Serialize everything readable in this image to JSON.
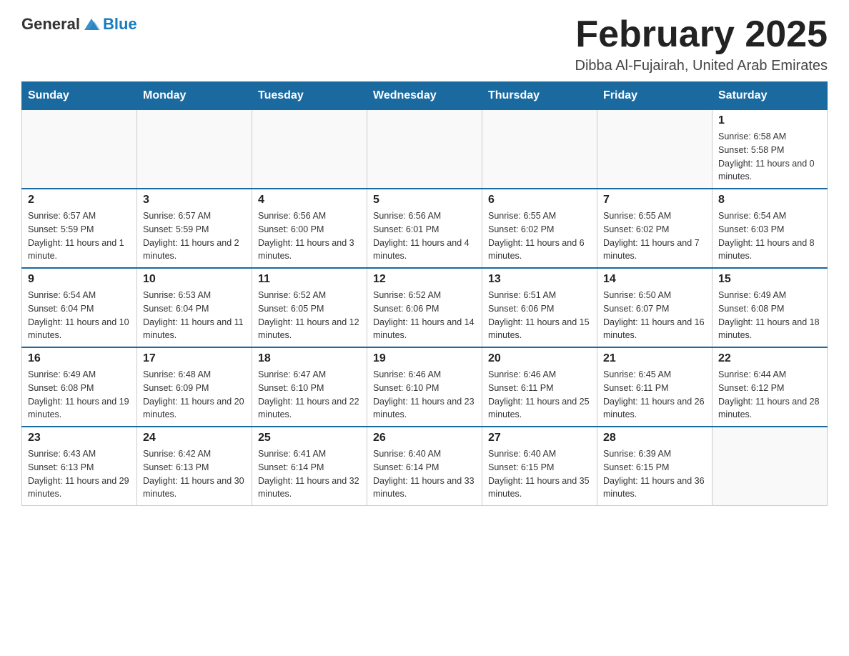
{
  "header": {
    "logo": {
      "text_general": "General",
      "text_blue": "Blue",
      "icon_alt": "GeneralBlue logo"
    },
    "title": "February 2025",
    "subtitle": "Dibba Al-Fujairah, United Arab Emirates"
  },
  "calendar": {
    "days_of_week": [
      "Sunday",
      "Monday",
      "Tuesday",
      "Wednesday",
      "Thursday",
      "Friday",
      "Saturday"
    ],
    "weeks": [
      [
        {
          "day": "",
          "info": ""
        },
        {
          "day": "",
          "info": ""
        },
        {
          "day": "",
          "info": ""
        },
        {
          "day": "",
          "info": ""
        },
        {
          "day": "",
          "info": ""
        },
        {
          "day": "",
          "info": ""
        },
        {
          "day": "1",
          "info": "Sunrise: 6:58 AM\nSunset: 5:58 PM\nDaylight: 11 hours and 0 minutes."
        }
      ],
      [
        {
          "day": "2",
          "info": "Sunrise: 6:57 AM\nSunset: 5:59 PM\nDaylight: 11 hours and 1 minute."
        },
        {
          "day": "3",
          "info": "Sunrise: 6:57 AM\nSunset: 5:59 PM\nDaylight: 11 hours and 2 minutes."
        },
        {
          "day": "4",
          "info": "Sunrise: 6:56 AM\nSunset: 6:00 PM\nDaylight: 11 hours and 3 minutes."
        },
        {
          "day": "5",
          "info": "Sunrise: 6:56 AM\nSunset: 6:01 PM\nDaylight: 11 hours and 4 minutes."
        },
        {
          "day": "6",
          "info": "Sunrise: 6:55 AM\nSunset: 6:02 PM\nDaylight: 11 hours and 6 minutes."
        },
        {
          "day": "7",
          "info": "Sunrise: 6:55 AM\nSunset: 6:02 PM\nDaylight: 11 hours and 7 minutes."
        },
        {
          "day": "8",
          "info": "Sunrise: 6:54 AM\nSunset: 6:03 PM\nDaylight: 11 hours and 8 minutes."
        }
      ],
      [
        {
          "day": "9",
          "info": "Sunrise: 6:54 AM\nSunset: 6:04 PM\nDaylight: 11 hours and 10 minutes."
        },
        {
          "day": "10",
          "info": "Sunrise: 6:53 AM\nSunset: 6:04 PM\nDaylight: 11 hours and 11 minutes."
        },
        {
          "day": "11",
          "info": "Sunrise: 6:52 AM\nSunset: 6:05 PM\nDaylight: 11 hours and 12 minutes."
        },
        {
          "day": "12",
          "info": "Sunrise: 6:52 AM\nSunset: 6:06 PM\nDaylight: 11 hours and 14 minutes."
        },
        {
          "day": "13",
          "info": "Sunrise: 6:51 AM\nSunset: 6:06 PM\nDaylight: 11 hours and 15 minutes."
        },
        {
          "day": "14",
          "info": "Sunrise: 6:50 AM\nSunset: 6:07 PM\nDaylight: 11 hours and 16 minutes."
        },
        {
          "day": "15",
          "info": "Sunrise: 6:49 AM\nSunset: 6:08 PM\nDaylight: 11 hours and 18 minutes."
        }
      ],
      [
        {
          "day": "16",
          "info": "Sunrise: 6:49 AM\nSunset: 6:08 PM\nDaylight: 11 hours and 19 minutes."
        },
        {
          "day": "17",
          "info": "Sunrise: 6:48 AM\nSunset: 6:09 PM\nDaylight: 11 hours and 20 minutes."
        },
        {
          "day": "18",
          "info": "Sunrise: 6:47 AM\nSunset: 6:10 PM\nDaylight: 11 hours and 22 minutes."
        },
        {
          "day": "19",
          "info": "Sunrise: 6:46 AM\nSunset: 6:10 PM\nDaylight: 11 hours and 23 minutes."
        },
        {
          "day": "20",
          "info": "Sunrise: 6:46 AM\nSunset: 6:11 PM\nDaylight: 11 hours and 25 minutes."
        },
        {
          "day": "21",
          "info": "Sunrise: 6:45 AM\nSunset: 6:11 PM\nDaylight: 11 hours and 26 minutes."
        },
        {
          "day": "22",
          "info": "Sunrise: 6:44 AM\nSunset: 6:12 PM\nDaylight: 11 hours and 28 minutes."
        }
      ],
      [
        {
          "day": "23",
          "info": "Sunrise: 6:43 AM\nSunset: 6:13 PM\nDaylight: 11 hours and 29 minutes."
        },
        {
          "day": "24",
          "info": "Sunrise: 6:42 AM\nSunset: 6:13 PM\nDaylight: 11 hours and 30 minutes."
        },
        {
          "day": "25",
          "info": "Sunrise: 6:41 AM\nSunset: 6:14 PM\nDaylight: 11 hours and 32 minutes."
        },
        {
          "day": "26",
          "info": "Sunrise: 6:40 AM\nSunset: 6:14 PM\nDaylight: 11 hours and 33 minutes."
        },
        {
          "day": "27",
          "info": "Sunrise: 6:40 AM\nSunset: 6:15 PM\nDaylight: 11 hours and 35 minutes."
        },
        {
          "day": "28",
          "info": "Sunrise: 6:39 AM\nSunset: 6:15 PM\nDaylight: 11 hours and 36 minutes."
        },
        {
          "day": "",
          "info": ""
        }
      ]
    ]
  }
}
